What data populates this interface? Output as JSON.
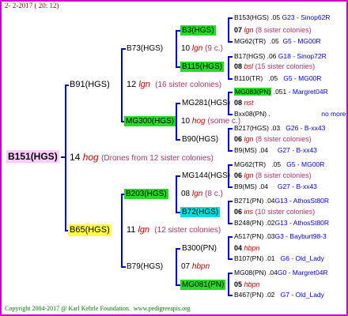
{
  "header": {
    "date": "2- 2-2017 ( 20: 12)"
  },
  "colors": {
    "queen_bg": "#ffccff",
    "gold_bg": "#ffff44",
    "green_bg": "#22dd22",
    "cyan_bg": "#00dddd",
    "line": "#0000cc"
  },
  "root": {
    "name": "B151(HGS)",
    "num": "14",
    "breed": "hog",
    "note": "(Drones from 12 sister colonies)"
  },
  "g1": [
    {
      "name": "B91(HGS)",
      "num": "12",
      "breed": "lgn",
      "note": "(16 sister colonies)"
    },
    {
      "name": "B65(HGS)",
      "num": "11",
      "breed": "lgn",
      "note": "(12 sister colonies)"
    }
  ],
  "g2": [
    {
      "name": "B73(HGS)",
      "num": "10",
      "breed": "lgn",
      "note": "(9 c.)"
    },
    {
      "name": "MG300(HGS)",
      "num": "10",
      "breed": "hog",
      "note": "(some c.)"
    },
    {
      "name": "B203(HGS)",
      "num": "08",
      "breed": "lgn",
      "note": "(8 c.)"
    },
    {
      "name": "B79(HGS)",
      "num": "07",
      "breed": "hbpn",
      "note": ""
    }
  ],
  "g3": [
    {
      "name": "B3(HGS)",
      "num": "07",
      "breed": "lgn",
      "note": "(8 sister colonies)"
    },
    {
      "name": "B115(HGS)",
      "num": "08",
      "breed": "bsl",
      "note": "(15 sister colonies)"
    },
    {
      "name": "MG281(HGS)",
      "num": "08",
      "breed": "nst",
      "note": ""
    },
    {
      "name": "B90(HGS)",
      "num": "06",
      "breed": "lgn",
      "note": "(8 sister colonies)"
    },
    {
      "name": "MG144(HGS)",
      "num": "06",
      "breed": "lgn",
      "note": "(8 sister colonies)"
    },
    {
      "name": "B72(HGS)",
      "num": "06",
      "breed": "ins",
      "note": "(10 sister colonies)"
    },
    {
      "name": "B300(PN)",
      "num": "04",
      "breed": "hbpn",
      "note": ""
    },
    {
      "name": "MG081(PN)",
      "num": "05",
      "breed": "hbpn",
      "note": ""
    }
  ],
  "g4": [
    {
      "name": "B153(HGS)",
      "num": ".05",
      "origin": "G23 - Sinop62R"
    },
    {
      "name": "MG62(TR)",
      "num": ".05",
      "origin": "G5 - MG00R"
    },
    {
      "name": "B17(HGS)",
      "num": ".06",
      "origin": "G18 - Sinop72R"
    },
    {
      "name": "B110(TR)",
      "num": ".05",
      "origin": "G5 - MG00R"
    },
    {
      "name": "MG083(PN)",
      "num": ".051",
      "origin": "- Margret04R"
    },
    {
      "name": "Bxx08(PN)",
      "num": ".",
      "origin": "no more"
    },
    {
      "name": "B217(HGS)",
      "num": ".03",
      "origin": "G26 - B-xx43"
    },
    {
      "name": "B9(MS)",
      "num": ".04",
      "origin": "G27 - B-xx43"
    },
    {
      "name": "MG62(TR)",
      "num": ".05",
      "origin": "G5 - MG00R"
    },
    {
      "name": "B9(MS)",
      "num": ".04",
      "origin": "G27 - B-xx43"
    },
    {
      "name": "B271(PN)",
      "num": ".04",
      "origin": "G13 - AthosSt80R"
    },
    {
      "name": "B248(PN)",
      "num": ".02",
      "origin": "G13 - AthosSt80R"
    },
    {
      "name": "A517(PN)",
      "num": ".03",
      "origin": "G3 - Bayburt98-3"
    },
    {
      "name": "B107(PN)",
      "num": ".01",
      "origin": "G6 - Old_Lady"
    },
    {
      "name": "MG08(PN)",
      "num": ".04",
      "origin": "G0 - Margret04R"
    },
    {
      "name": "B467(PN)",
      "num": ".02",
      "origin": "G7 - Old_Lady"
    }
  ],
  "footer": {
    "copyright": "Copyright 2004-2017 @ Karl Kehrle Foundation.",
    "site": "www.pedigreeapis.org"
  }
}
